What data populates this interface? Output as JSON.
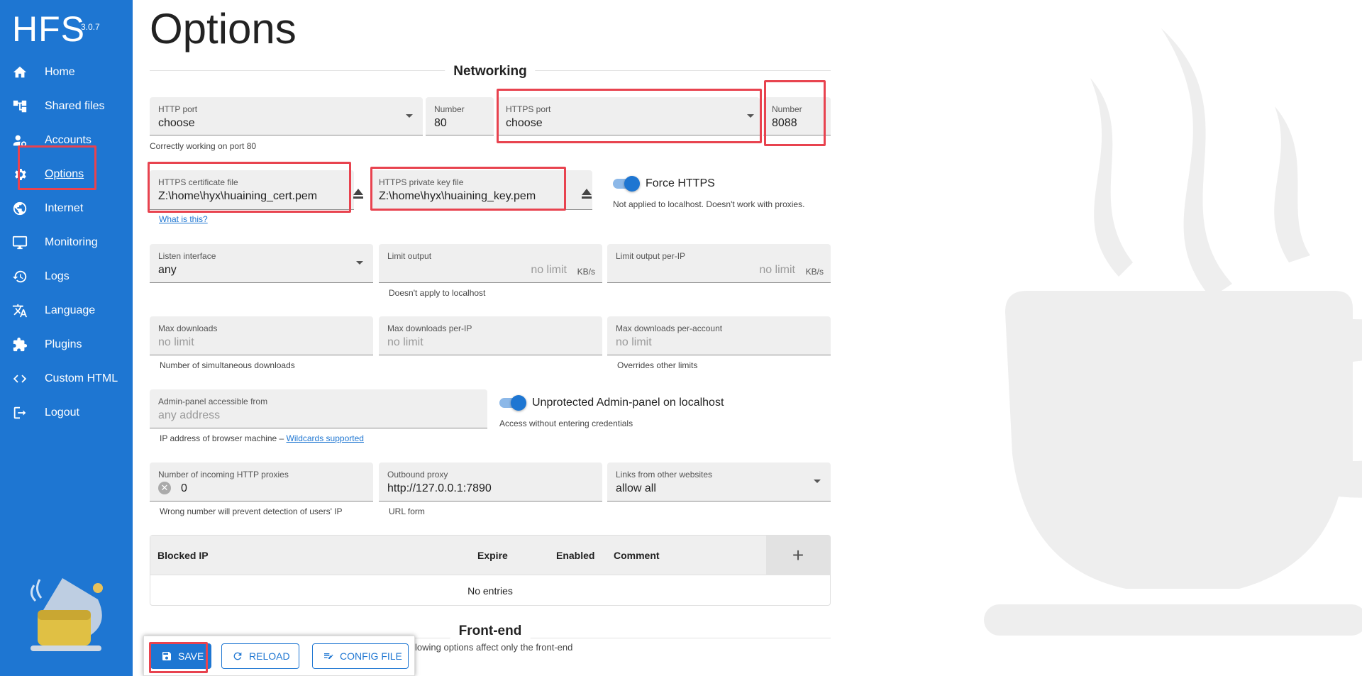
{
  "app": {
    "name": "HFS",
    "version": "3.0.7"
  },
  "sidebar": {
    "items": [
      {
        "label": "Home",
        "icon": "home-icon"
      },
      {
        "label": "Shared files",
        "icon": "tree-icon"
      },
      {
        "label": "Accounts",
        "icon": "accounts-icon"
      },
      {
        "label": "Options",
        "icon": "gear-icon",
        "active": true
      },
      {
        "label": "Internet",
        "icon": "globe-icon"
      },
      {
        "label": "Monitoring",
        "icon": "monitor-icon"
      },
      {
        "label": "Logs",
        "icon": "history-icon"
      },
      {
        "label": "Language",
        "icon": "translate-icon"
      },
      {
        "label": "Plugins",
        "icon": "puzzle-icon"
      },
      {
        "label": "Custom HTML",
        "icon": "code-icon"
      },
      {
        "label": "Logout",
        "icon": "logout-icon"
      }
    ]
  },
  "page": {
    "title": "Options",
    "networking": {
      "heading": "Networking",
      "http_port": {
        "label": "HTTP port",
        "value": "choose"
      },
      "http_number": {
        "label": "Number",
        "value": "80"
      },
      "http_help": "Correctly working on port 80",
      "https_port": {
        "label": "HTTPS port",
        "value": "choose"
      },
      "https_number": {
        "label": "Number",
        "value": "8088"
      },
      "cert": {
        "label": "HTTPS certificate file",
        "value": "Z:\\home\\hyx\\huaining_cert.pem"
      },
      "cert_help": "What is this?",
      "key": {
        "label": "HTTPS private key file",
        "value": "Z:\\home\\hyx\\huaining_key.pem"
      },
      "force_https": {
        "label": "Force HTTPS",
        "help": "Not applied to localhost. Doesn't work with proxies.",
        "on": true
      },
      "listen": {
        "label": "Listen interface",
        "value": "any"
      },
      "limit_output": {
        "label": "Limit output",
        "placeholder": "no limit",
        "unit": "KB/s",
        "help": "Doesn't apply to localhost"
      },
      "limit_output_ip": {
        "label": "Limit output per-IP",
        "placeholder": "no limit",
        "unit": "KB/s"
      },
      "max_downloads": {
        "label": "Max downloads",
        "placeholder": "no limit",
        "help": "Number of simultaneous downloads"
      },
      "max_downloads_ip": {
        "label": "Max downloads per-IP",
        "placeholder": "no limit"
      },
      "max_downloads_account": {
        "label": "Max downloads per-account",
        "placeholder": "no limit",
        "help": "Overrides other limits"
      },
      "admin_from": {
        "label": "Admin-panel accessible from",
        "placeholder": "any address",
        "help": "IP address of browser machine – ",
        "help_link": "Wildcards supported"
      },
      "unprotected_admin": {
        "label": "Unprotected Admin-panel on localhost",
        "help": "Access without entering credentials",
        "on": true
      },
      "proxies": {
        "label": "Number of incoming HTTP proxies",
        "value": "0",
        "help": "Wrong number will prevent detection of users' IP"
      },
      "outbound_proxy": {
        "label": "Outbound proxy",
        "value": "http://127.0.0.1:7890",
        "help": "URL form"
      },
      "links_from": {
        "label": "Links from other websites",
        "value": "allow all"
      }
    },
    "blocked": {
      "columns": [
        "Blocked IP",
        "Expire",
        "Enabled",
        "Comment"
      ],
      "add_label": "+",
      "empty": "No entries"
    },
    "frontend": {
      "heading": "Front-end",
      "help": "lowing options affect only the front-end"
    },
    "buttons": {
      "save": "SAVE",
      "reload": "RELOAD",
      "config": "CONFIG FILE"
    }
  },
  "colors": {
    "sidebar": "#1e76d2",
    "highlight": "#e8434f",
    "field": "#efefef"
  }
}
